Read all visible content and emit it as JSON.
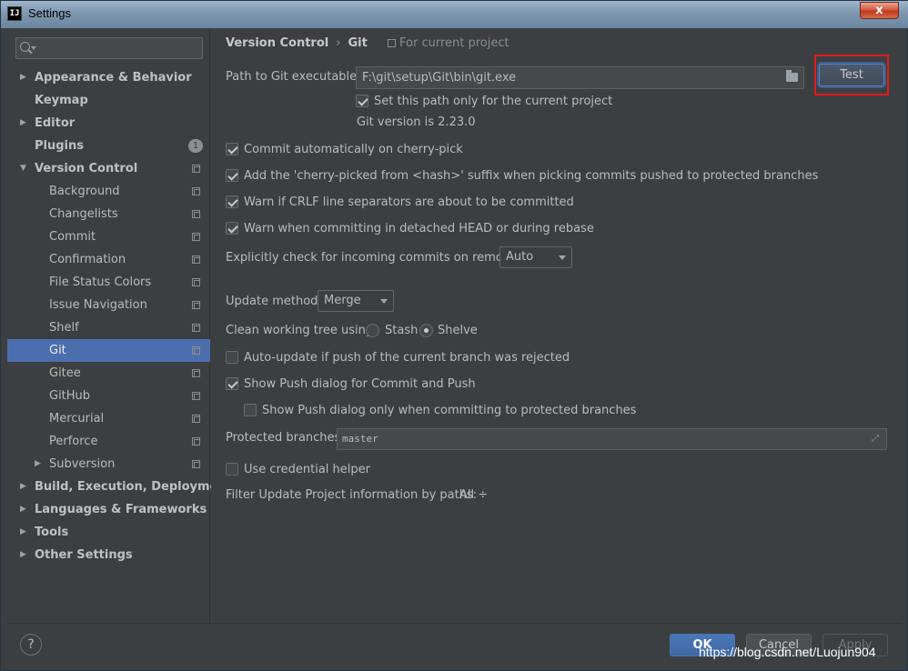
{
  "window": {
    "title": "Settings",
    "app_icon": "IJ",
    "close": "x"
  },
  "search": {
    "placeholder": ""
  },
  "tree": [
    {
      "label": "Appearance & Behavior",
      "level": 0,
      "expand": "collapsed"
    },
    {
      "label": "Keymap",
      "level": 0,
      "expand": "none"
    },
    {
      "label": "Editor",
      "level": 0,
      "expand": "collapsed"
    },
    {
      "label": "Plugins",
      "level": 0,
      "expand": "none",
      "badge": "1"
    },
    {
      "label": "Version Control",
      "level": 0,
      "expand": "expanded",
      "copy": true
    },
    {
      "label": "Background",
      "level": 1,
      "copy": true
    },
    {
      "label": "Changelists",
      "level": 1,
      "copy": true
    },
    {
      "label": "Commit",
      "level": 1,
      "copy": true
    },
    {
      "label": "Confirmation",
      "level": 1,
      "copy": true
    },
    {
      "label": "File Status Colors",
      "level": 1,
      "copy": true
    },
    {
      "label": "Issue Navigation",
      "level": 1,
      "copy": true
    },
    {
      "label": "Shelf",
      "level": 1,
      "copy": true
    },
    {
      "label": "Git",
      "level": 1,
      "copy": true,
      "selected": true
    },
    {
      "label": "Gitee",
      "level": 1,
      "copy": true
    },
    {
      "label": "GitHub",
      "level": 1,
      "copy": true
    },
    {
      "label": "Mercurial",
      "level": 1,
      "copy": true
    },
    {
      "label": "Perforce",
      "level": 1,
      "copy": true
    },
    {
      "label": "Subversion",
      "level": 1,
      "expand": "collapsed",
      "copy": true
    },
    {
      "label": "Build, Execution, Deployment",
      "level": 0,
      "expand": "collapsed"
    },
    {
      "label": "Languages & Frameworks",
      "level": 0,
      "expand": "collapsed"
    },
    {
      "label": "Tools",
      "level": 0,
      "expand": "collapsed"
    },
    {
      "label": "Other Settings",
      "level": 0,
      "expand": "collapsed"
    }
  ],
  "breadcrumb": {
    "parent": "Version Control",
    "separator": "›",
    "current": "Git",
    "scope": "For current project"
  },
  "git": {
    "path_label": "Path to Git executable:",
    "path_value": "F:\\git\\setup\\Git\\bin\\git.exe",
    "test_label": "Test",
    "current_project_only": {
      "label": "Set this path only for the current project",
      "checked": true
    },
    "version_text": "Git version is 2.23.0",
    "options": [
      {
        "label": "Commit automatically on cherry-pick",
        "checked": true
      },
      {
        "label": "Add the 'cherry-picked from <hash>' suffix when picking commits pushed to protected branches",
        "checked": true
      },
      {
        "label": "Warn if CRLF line separators are about to be committed",
        "checked": true
      },
      {
        "label": "Warn when committing in detached HEAD or during rebase",
        "checked": true
      }
    ],
    "incoming_label": "Explicitly check for incoming commits on remotes:",
    "incoming_value": "Auto",
    "update_label": "Update method:",
    "update_value": "Merge",
    "clean_label": "Clean working tree using:",
    "clean_stash": "Stash",
    "clean_shelve": "Shelve",
    "clean_selected": "Shelve",
    "auto_update": {
      "label": "Auto-update if push of the current branch was rejected",
      "checked": false
    },
    "show_push": {
      "label": "Show Push dialog for Commit and Push",
      "checked": true
    },
    "show_push_protected": {
      "label": "Show Push dialog only when committing to protected branches",
      "checked": false
    },
    "protected_label": "Protected branches:",
    "protected_value": "master",
    "credential": {
      "label": "Use credential helper",
      "checked": false
    },
    "filter_label": "Filter Update Project information by paths:",
    "filter_value": "All ÷"
  },
  "footer": {
    "help": "?",
    "ok": "OK",
    "cancel": "Cancel",
    "apply": "Apply"
  },
  "watermark": "https://blog.csdn.net/Luojun904"
}
